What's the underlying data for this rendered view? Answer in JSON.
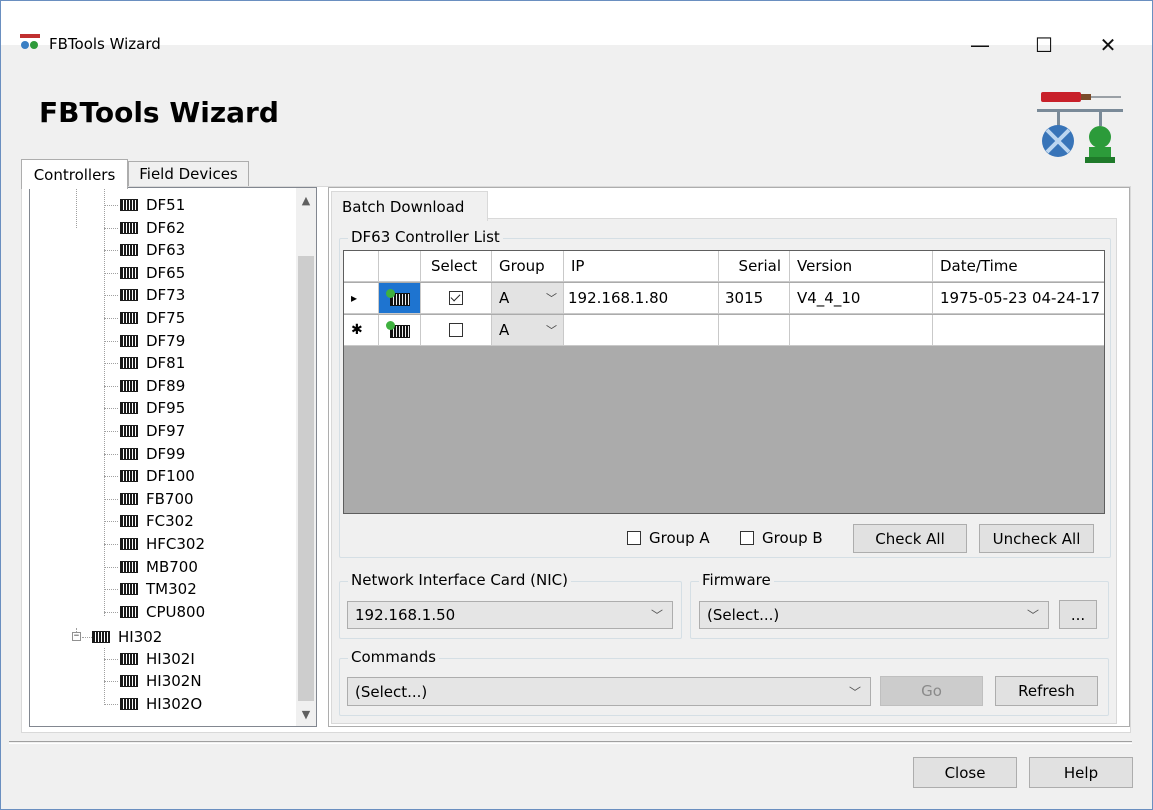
{
  "window": {
    "title": "FBTools Wizard",
    "minimize": "—",
    "maximize": "☐",
    "close": "✕"
  },
  "header": {
    "title": "FBTools Wizard"
  },
  "main_tabs": [
    {
      "label": "Controllers",
      "active": true
    },
    {
      "label": "Field Devices",
      "active": false
    }
  ],
  "tree": {
    "items": [
      "DF51",
      "DF62",
      "DF63",
      "DF65",
      "DF73",
      "DF75",
      "DF79",
      "DF81",
      "DF89",
      "DF95",
      "DF97",
      "DF99",
      "DF100",
      "FB700",
      "FC302",
      "HFC302",
      "MB700",
      "TM302",
      "CPU800"
    ],
    "parent": {
      "label": "HI302",
      "expander": "−"
    },
    "children": [
      "HI302I",
      "HI302N",
      "HI302O"
    ],
    "scroll_up": "▲",
    "scroll_down": "▼"
  },
  "content_tab": {
    "label": "Batch Download"
  },
  "controller_list": {
    "title": "DF63 Controller List",
    "columns": [
      "Select",
      "Group",
      "IP",
      "Serial",
      "Version",
      "Date/Time"
    ],
    "rows": [
      {
        "marker": "▸",
        "selected": true,
        "group": "A",
        "ip": "192.168.1.80",
        "serial": "3015",
        "version": "V4_4_10",
        "datetime": "1975-05-23 04-24-17"
      },
      {
        "marker": "✱",
        "selected": false,
        "group": "A",
        "ip": "",
        "serial": "",
        "version": "",
        "datetime": ""
      }
    ],
    "group_a_label": "Group A",
    "group_b_label": "Group B",
    "check_all_label": "Check All",
    "uncheck_all_label": "Uncheck All"
  },
  "nic": {
    "title": "Network Interface Card (NIC)",
    "value": "192.168.1.50"
  },
  "firmware": {
    "title": "Firmware",
    "value": "(Select...)",
    "browse_label": "..."
  },
  "commands": {
    "title": "Commands",
    "value": "(Select...)",
    "go_label": "Go",
    "refresh_label": "Refresh"
  },
  "footer": {
    "close_label": "Close",
    "help_label": "Help"
  },
  "icons": {
    "combo_arrow": "﹀"
  }
}
